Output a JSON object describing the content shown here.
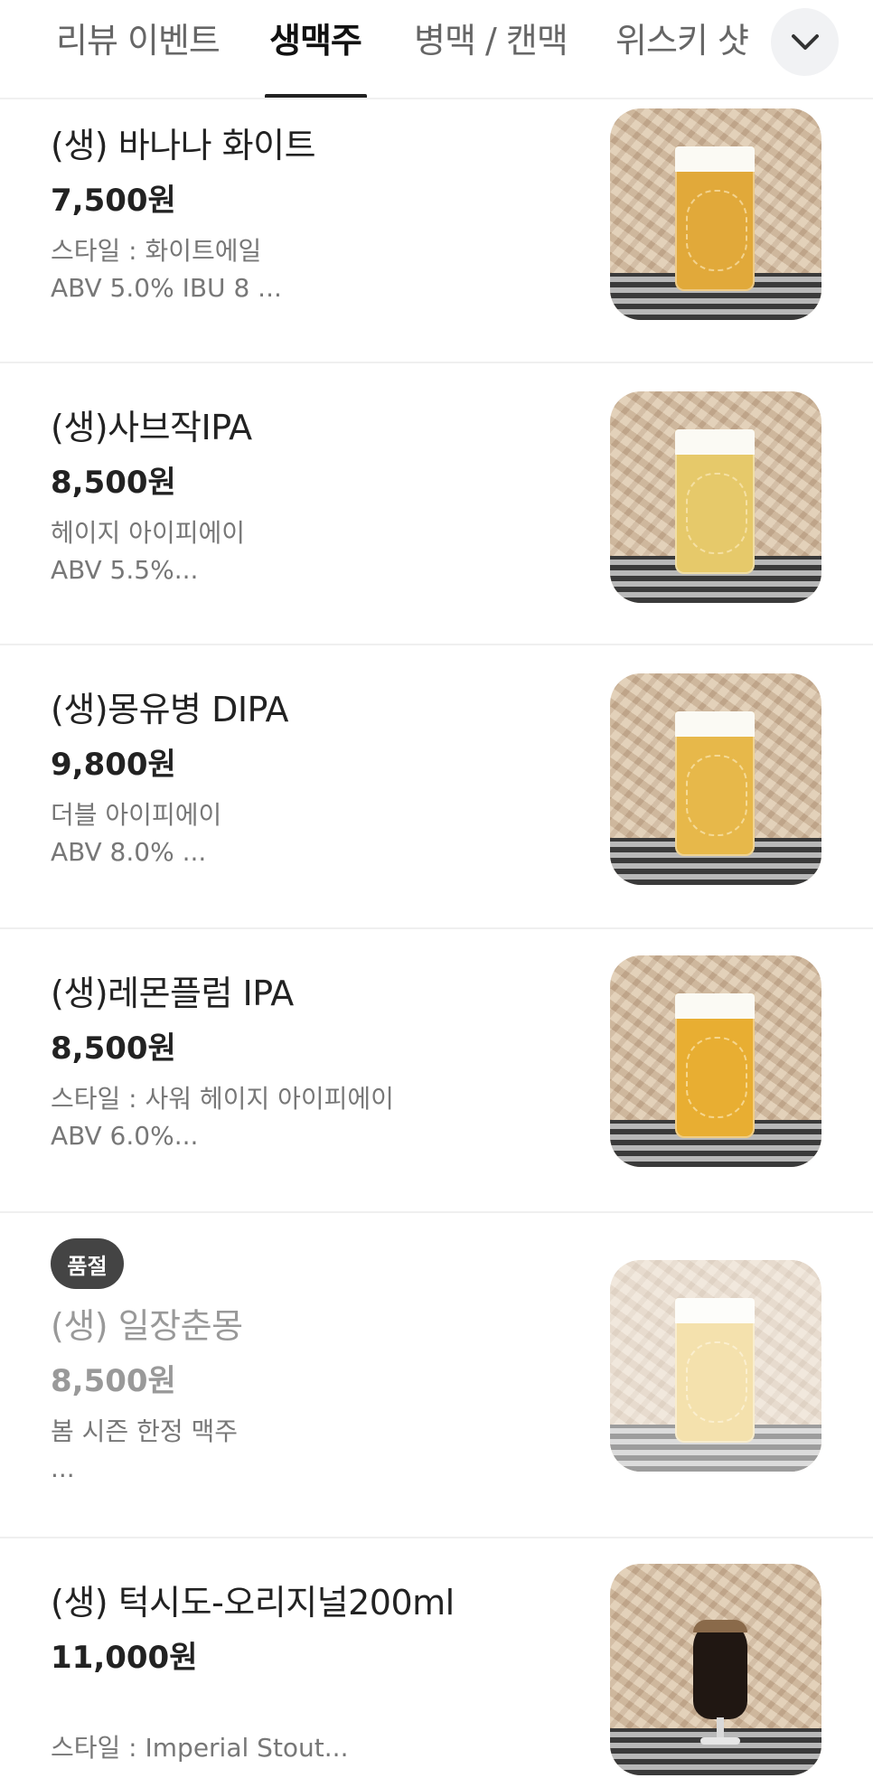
{
  "tabs": [
    {
      "label": "리뷰 이벤트"
    },
    {
      "label": "생맥주",
      "active": true
    },
    {
      "label": "병맥 / 캔맥"
    },
    {
      "label": "위스키 샷"
    }
  ],
  "more_icon": "chevron-down-icon",
  "items": [
    {
      "name": "(생) 바나나 화이트",
      "price": "7,500원",
      "desc1": "스타일 : 화이트에일",
      "desc2": " ABV 5.0%     IBU 8 ...",
      "image_icon": "beer-glass-image"
    },
    {
      "name": "(생)사브작IPA",
      "price": "8,500원",
      "desc1": "헤이지 아이피에이",
      "desc2": "ABV 5.5%...",
      "image_icon": "beer-glass-image"
    },
    {
      "name": "(생)몽유병 DIPA",
      "price": "9,800원",
      "desc1": "더블 아이피에이",
      "desc2": "ABV 8.0% ...",
      "image_icon": "beer-glass-image"
    },
    {
      "name": "(생)레몬플럼 IPA",
      "price": "8,500원",
      "desc1": "스타일 : 사워 헤이지 아이피에이",
      "desc2": "ABV 6.0%...",
      "image_icon": "beer-glass-image"
    },
    {
      "badge": "품절",
      "name": "(생) 일장춘몽",
      "price": "8,500원",
      "desc1": "봄 시즌 한정 맥주",
      "desc2": "...",
      "image_icon": "beer-glass-image",
      "sold_out": true
    },
    {
      "name": "(생) 턱시도-오리지널200ml",
      "price": "11,000원",
      "desc1": "",
      "desc2": "스타일 :  Imperial Stout...",
      "image_icon": "stout-glass-image"
    }
  ],
  "colors": {
    "sold_out_badge": "#444444",
    "active_tab": "#111111",
    "price": "#222222",
    "desc": "#777777"
  }
}
